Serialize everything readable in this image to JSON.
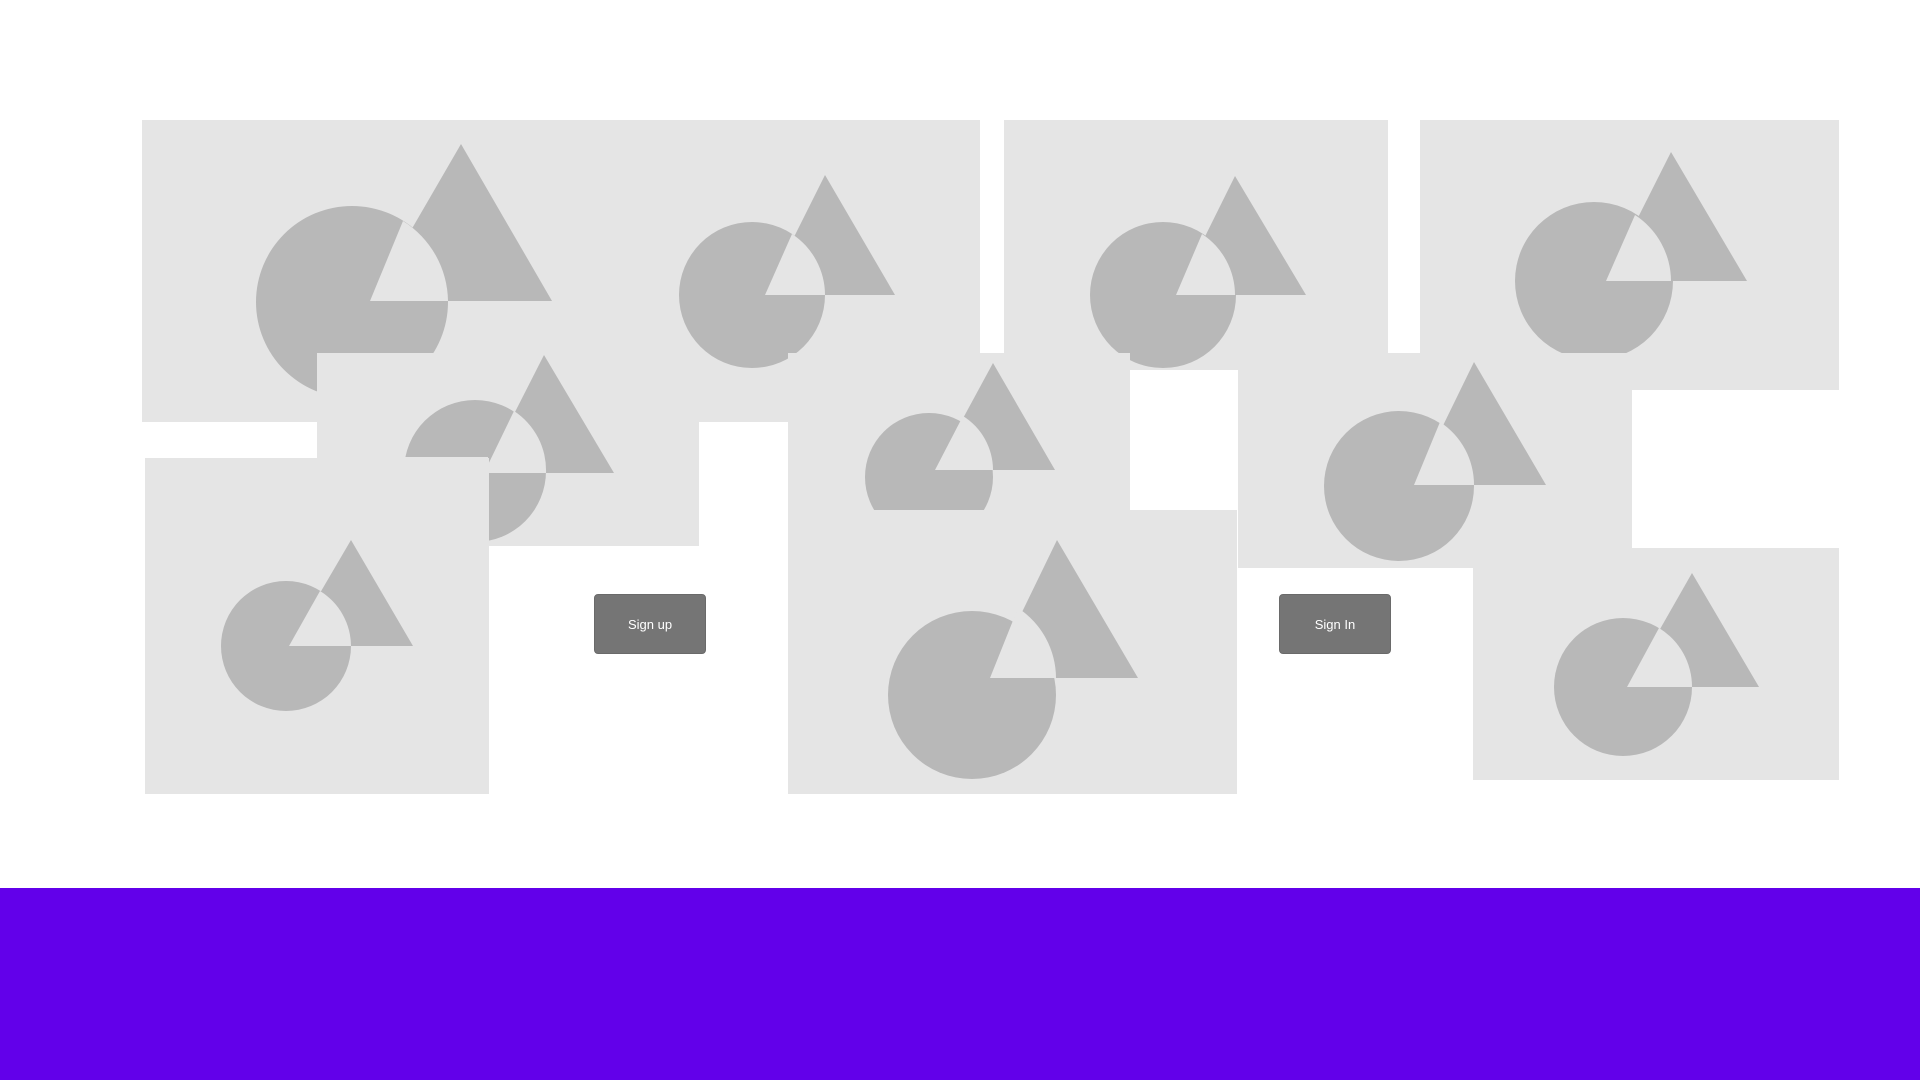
{
  "page": {
    "background": "#ffffff",
    "placeholder_fill": "#e5e5e5",
    "shape_fill": "#b8b8b8"
  },
  "image_placeholders": [
    {
      "name": "image-placeholder-1",
      "icon": "image-icon"
    },
    {
      "name": "image-placeholder-2",
      "icon": "image-icon"
    },
    {
      "name": "image-placeholder-3",
      "icon": "image-icon"
    },
    {
      "name": "image-placeholder-4",
      "icon": "image-icon"
    },
    {
      "name": "image-placeholder-5",
      "icon": "image-icon"
    },
    {
      "name": "image-placeholder-6",
      "icon": "image-icon"
    },
    {
      "name": "image-placeholder-7",
      "icon": "image-icon"
    },
    {
      "name": "image-placeholder-8",
      "icon": "image-icon"
    },
    {
      "name": "image-placeholder-9",
      "icon": "image-icon"
    },
    {
      "name": "image-placeholder-10",
      "icon": "image-icon"
    }
  ],
  "buttons": {
    "sign_up_label": "Sign up",
    "sign_in_label": "Sign In",
    "color": "#757575",
    "text_color": "#ffffff"
  },
  "footer": {
    "color": "#6200ea"
  }
}
